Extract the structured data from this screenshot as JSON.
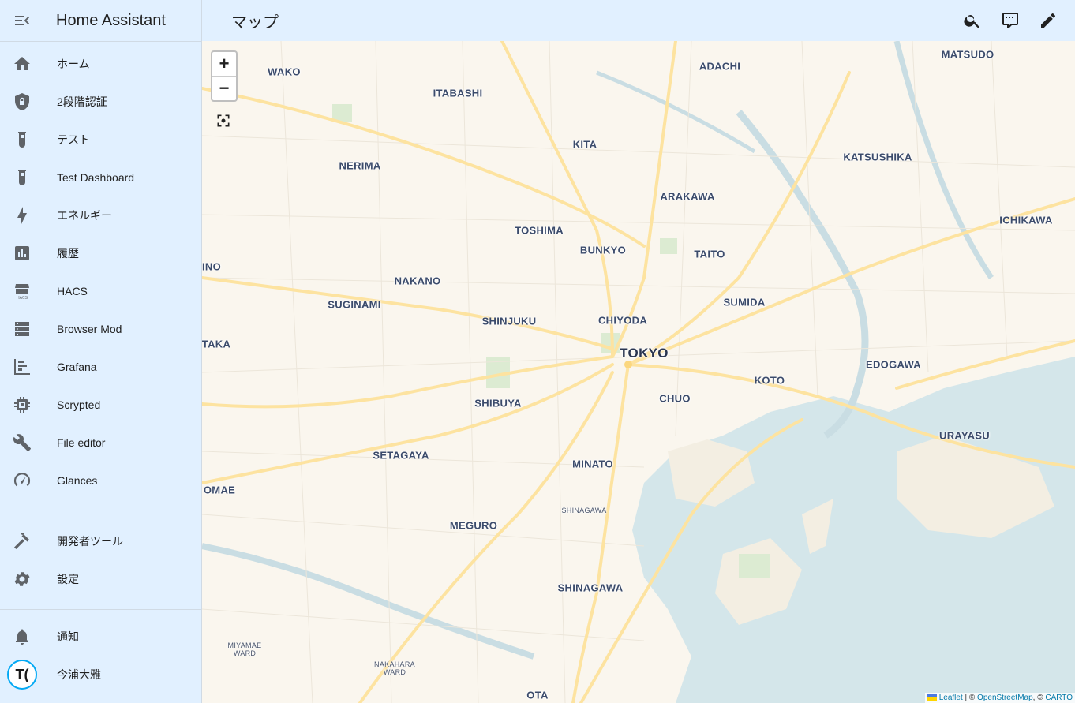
{
  "app": {
    "title": "Home Assistant"
  },
  "page": {
    "title": "マップ"
  },
  "sidebar": {
    "items": [
      {
        "label": "ホーム",
        "icon": "home-icon"
      },
      {
        "label": "2段階認証",
        "icon": "shield-lock-icon"
      },
      {
        "label": "テスト",
        "icon": "test-tube-icon"
      },
      {
        "label": "Test Dashboard",
        "icon": "test-tube-icon"
      },
      {
        "label": "エネルギー",
        "icon": "lightning-bolt-icon"
      },
      {
        "label": "履歴",
        "icon": "chart-box-icon"
      },
      {
        "label": "HACS",
        "icon": "hacs-icon"
      },
      {
        "label": "Browser Mod",
        "icon": "server-icon"
      },
      {
        "label": "Grafana",
        "icon": "chart-timeline-icon"
      },
      {
        "label": "Scrypted",
        "icon": "chip-icon"
      },
      {
        "label": "File editor",
        "icon": "wrench-icon"
      },
      {
        "label": "Glances",
        "icon": "gauge-icon"
      }
    ],
    "dev_tools": {
      "label": "開発者ツール",
      "icon": "hammer-icon"
    },
    "settings": {
      "label": "設定",
      "icon": "cog-icon"
    },
    "notifications": {
      "label": "通知",
      "icon": "bell-icon"
    },
    "user": {
      "label": "今浦大雅",
      "initials": "T("
    }
  },
  "toolbar": {
    "icons": [
      "search-icon",
      "comment-icon",
      "pencil-icon"
    ]
  },
  "map": {
    "zoom_in": "+",
    "zoom_out": "−",
    "labels": {
      "wako": "WAKO",
      "adachi": "ADACHI",
      "matsudo": "MATSUDO",
      "itabashi": "ITABASHI",
      "kita": "KITA",
      "nerima": "NERIMA",
      "katsushika": "KATSUSHIKA",
      "arakawa": "ARAKAWA",
      "ichikawa": "ICHIKAWA",
      "toshima": "TOSHIMA",
      "bunkyo": "BUNKYO",
      "taito": "TAITO",
      "ino": "INO",
      "nakano": "NAKANO",
      "suginami": "SUGINAMI",
      "sumida": "SUMIDA",
      "shinjuku": "SHINJUKU",
      "chiyoda": "CHIYODA",
      "tokyo": "TOKYO",
      "taka": "TAKA",
      "edogawa": "EDOGAWA",
      "koto": "KOTO",
      "chuo": "CHUO",
      "shibuya": "SHIBUYA",
      "urayasu": "URAYASU",
      "setagaya": "SETAGAYA",
      "minato": "MINATO",
      "omae": "OMAE",
      "shinagawa_small": "SHINAGAWA",
      "meguro": "MEGURO",
      "shinagawa": "SHINAGAWA",
      "miyamae_1": "MIYAMAE",
      "miyamae_2": "WARD",
      "nakahara_1": "NAKAHARA",
      "nakahara_2": "WARD",
      "ota": "OTA"
    },
    "attribution": {
      "leaflet": "Leaflet",
      "sep1": " | © ",
      "osm": "OpenStreetMap",
      "sep2": ", © ",
      "carto": "CARTO"
    }
  },
  "colors": {
    "sidebar_bg": "#e1f0ff",
    "water": "#d4e6ea",
    "road_major": "#fde3a0",
    "accent": "#03a9f4"
  }
}
